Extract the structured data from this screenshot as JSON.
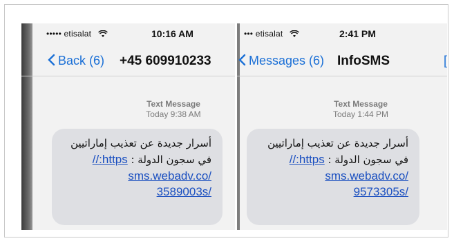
{
  "left": {
    "carrier": "••••• etisalat",
    "time": "10:16 AM",
    "back_label": "Back (6)",
    "title": "+45 609910233",
    "meta_kind": "Text Message",
    "meta_time": "Today 9:38 AM",
    "msg_line1": "أسرار جديدة عن تعذيب إماراتيين",
    "msg_line2": "في سجون الدولة :",
    "link_part1": "https://",
    "link_part2": "sms.webadv.co/",
    "link_part3": "3589003s/"
  },
  "right": {
    "carrier": "••• etisalat",
    "time": "2:41 PM",
    "back_label": "Messages (6)",
    "title": "InfoSMS",
    "meta_kind": "Text Message",
    "meta_time": "Today 1:44 PM",
    "msg_line1": "أسرار جديدة عن تعذيب إماراتيين",
    "msg_line2": "في سجون الدولة :",
    "link_part1": "https://",
    "link_part2": "sms.webadv.co/",
    "link_part3": "9573305s/"
  },
  "colors": {
    "ios_blue": "#1a6fd6",
    "bubble_gray": "#dedfe3",
    "link_blue": "#1a4fc0"
  },
  "icons": [
    "wifi-icon",
    "chevron-left-icon"
  ]
}
